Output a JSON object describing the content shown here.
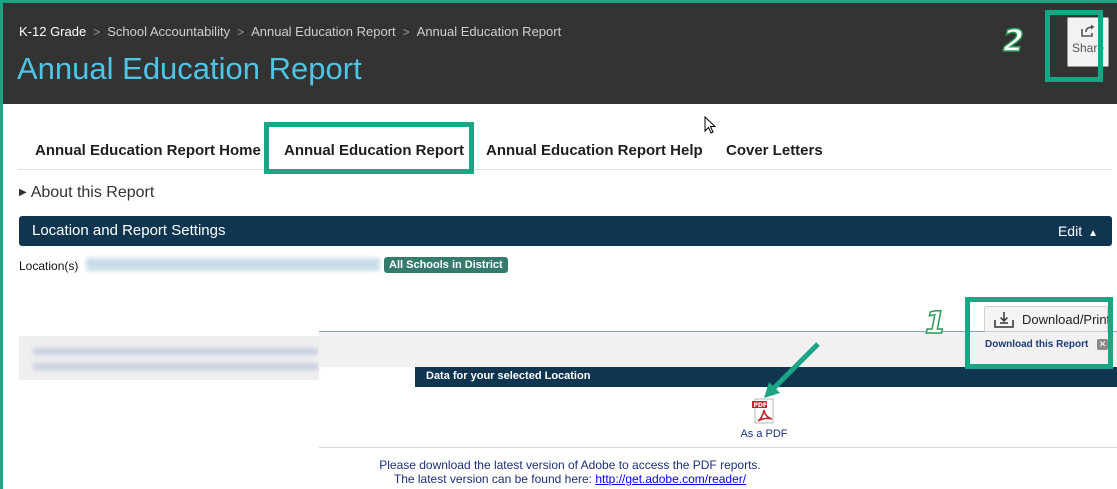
{
  "header": {
    "breadcrumb": [
      "K-12 Grade",
      "School Accountability",
      "Annual Education Report",
      "Annual Education Report"
    ],
    "title": "Annual Education Report",
    "share_label": "Share"
  },
  "callouts": {
    "one": "1",
    "two": "2"
  },
  "tabs": [
    {
      "label": "Annual Education Report Home"
    },
    {
      "label": "Annual Education Report"
    },
    {
      "label": "Annual Education Report Help"
    },
    {
      "label": "Cover Letters"
    }
  ],
  "about": "About this Report",
  "settings": {
    "title": "Location and Report Settings",
    "edit": "Edit"
  },
  "location": {
    "label": "Location(s)",
    "badge": "All Schools in District"
  },
  "download": {
    "button": "Download/Print",
    "subtitle": "Download this Report",
    "data_bar": "Data for your selected Location",
    "pdf_label": "As a PDF",
    "note_line1": "Please download the latest version of Adobe to access the PDF reports.",
    "note_line2_prefix": "The latest version can be found here:",
    "note_link": "http://get.adobe.com/reader/"
  },
  "icons": {
    "share": "share-icon",
    "download": "download-tray-icon",
    "pdf": "pdf-file-icon",
    "close": "close-icon",
    "cursor": "mouse-cursor-icon",
    "arrow": "pointer-arrow-icon"
  },
  "colors": {
    "header_bg": "#333333",
    "title": "#4fc4e7",
    "highlight": "#1aa585",
    "bar": "#0f3550",
    "badge": "#347b6d"
  }
}
